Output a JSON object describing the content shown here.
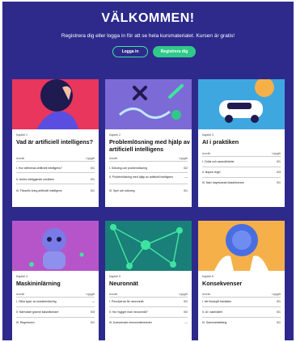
{
  "hero": {
    "title": "VÄLKOMMEN!",
    "subtitle": "Registrera dig eller logga in för att se hela kursmaterialet. Kursen är gratis!",
    "login_label": "Logga in",
    "register_label": "Registrera dig"
  },
  "cards": [
    {
      "chapter": "Kapitel 1",
      "title": "Vad är artificiell intelligens?",
      "col_left": "Avsnitt",
      "col_right": "Uppgift",
      "items": [
        {
          "label": "I. Hur definieras artificiell intelligens?",
          "count": "0/1"
        },
        {
          "label": "II. Andra närliggande områden",
          "count": "0/1"
        },
        {
          "label": "III. Filosofin kring artificiell intelligens",
          "count": "0/1"
        }
      ]
    },
    {
      "chapter": "Kapitel 2",
      "title": "Problemlösning med hjälp av artificiell intelligens",
      "col_left": "Avsnitt",
      "col_right": "Uppgift",
      "items": [
        {
          "label": "I. Sökning och problemlösning",
          "count": "0/2"
        },
        {
          "label": "II. Problemlösning med hjälp av artificiell intelligens",
          "count": "—"
        },
        {
          "label": "III. Spel och sökning",
          "count": "0/1"
        }
      ]
    },
    {
      "chapter": "Kapitel 3",
      "title": "AI i praktiken",
      "col_left": "Avsnitt",
      "col_right": "Uppgift",
      "items": [
        {
          "label": "I. Odds och sannolikheter",
          "count": "0/1"
        },
        {
          "label": "II. Bayes regel",
          "count": "0/3"
        },
        {
          "label": "III. Naiv bayesiansk klassificerare",
          "count": "0/1"
        }
      ]
    },
    {
      "chapter": "Kapitel 4",
      "title": "Maskininlärning",
      "col_left": "Avsnitt",
      "col_right": "Uppgift",
      "items": [
        {
          "label": "I. Olika typer av maskininlärning",
          "count": "—"
        },
        {
          "label": "II. Närmaste granne klassificerare",
          "count": "0/3"
        },
        {
          "label": "III. Regression",
          "count": "0/1"
        }
      ]
    },
    {
      "chapter": "Kapitel 5",
      "title": "Neuronnät",
      "col_left": "Avsnitt",
      "col_right": "Uppgift",
      "items": [
        {
          "label": "I. Principerna för neuronnät",
          "count": "0/1"
        },
        {
          "label": "II. Hur bygger man neuronnät?",
          "count": "0/2"
        },
        {
          "label": "III. Avancerade neuronnätmetoder",
          "count": "—"
        }
      ]
    },
    {
      "chapter": "Kapitel 6",
      "title": "Konsekvenser",
      "col_left": "Avsnitt",
      "col_right": "Uppgift",
      "items": [
        {
          "label": "I. Att förutspå framtiden",
          "count": "0/1"
        },
        {
          "label": "II. AI i samhället",
          "count": "0/1"
        },
        {
          "label": "III. Sammanfattning",
          "count": "0/1"
        }
      ]
    }
  ],
  "colors": {
    "background": "#2d2a8c",
    "accent": "#2fc98a",
    "card_1_image": "#e8365d",
    "card_2_image": "#7c6ad6",
    "card_3_image": "#3ea7e0",
    "card_4_image": "#b655c9",
    "card_5_image": "#1a7f78",
    "card_6_image": "#f5b04a"
  }
}
